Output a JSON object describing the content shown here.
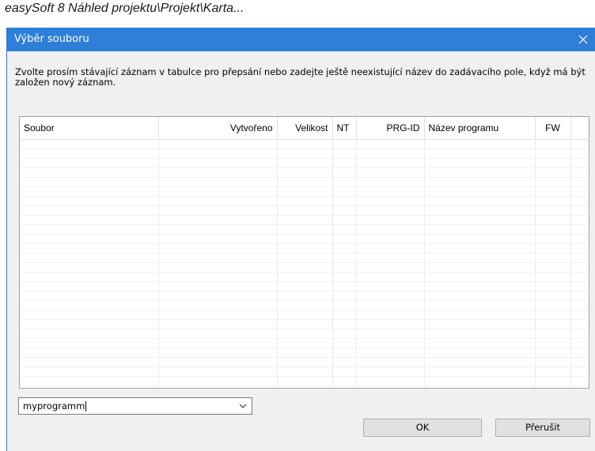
{
  "document": {
    "title": "easySoft 8 Náhled projektu\\Projekt\\Karta..."
  },
  "dialog": {
    "title": "Výběr souboru",
    "close_icon": "close-icon",
    "instructions": "Zvolte prosím stávající záznam v tabulce pro přepsání nebo zadejte ještě neexistující název do zadávacího pole, když má být založen nový záznam.",
    "columns": [
      "Soubor",
      "Vytvořeno",
      "Velikost",
      "NT",
      "PRG-ID",
      "Název programu",
      "FW",
      ""
    ],
    "rows": [],
    "filename_value": "myprogramm",
    "ok_label": "OK",
    "cancel_label": "Přerušit",
    "accent_color": "#2d7fd8"
  }
}
